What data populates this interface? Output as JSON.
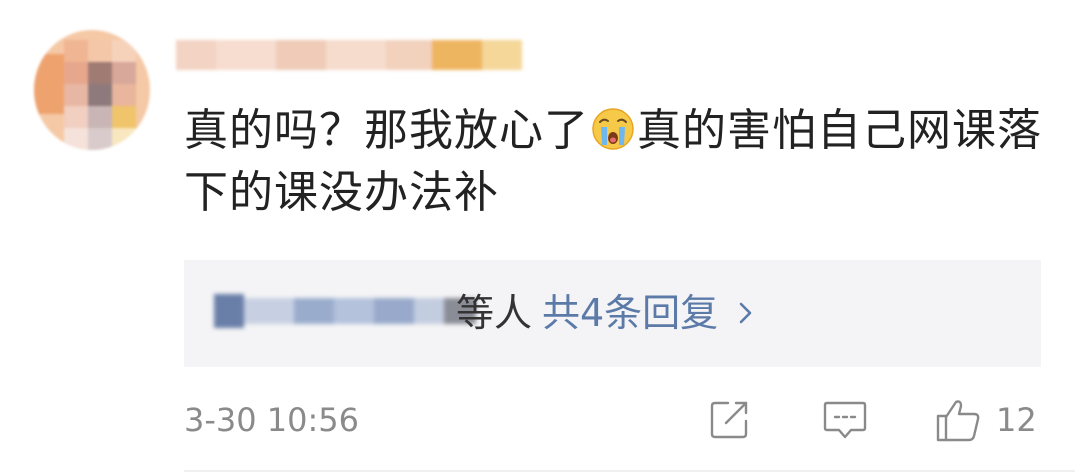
{
  "comment": {
    "text_part1": "真的吗？那我放心了",
    "emoji_name": "crying-face-emoji",
    "text_part2": "真的害怕自己网课落下的课没办法补",
    "replies": {
      "suffix": "等人",
      "link_label": "共4条回复",
      "chevron_icon": "chevron-right-icon"
    },
    "timestamp": "3-30 10:56",
    "actions": {
      "share_icon": "share-icon",
      "reply_icon": "comment-icon",
      "like_icon": "thumbs-up-icon",
      "like_count": "12"
    }
  },
  "colors": {
    "text": "#222222",
    "link": "#5b7aa8",
    "meta": "#8a8a8a",
    "reply_bg": "#f4f4f6"
  }
}
